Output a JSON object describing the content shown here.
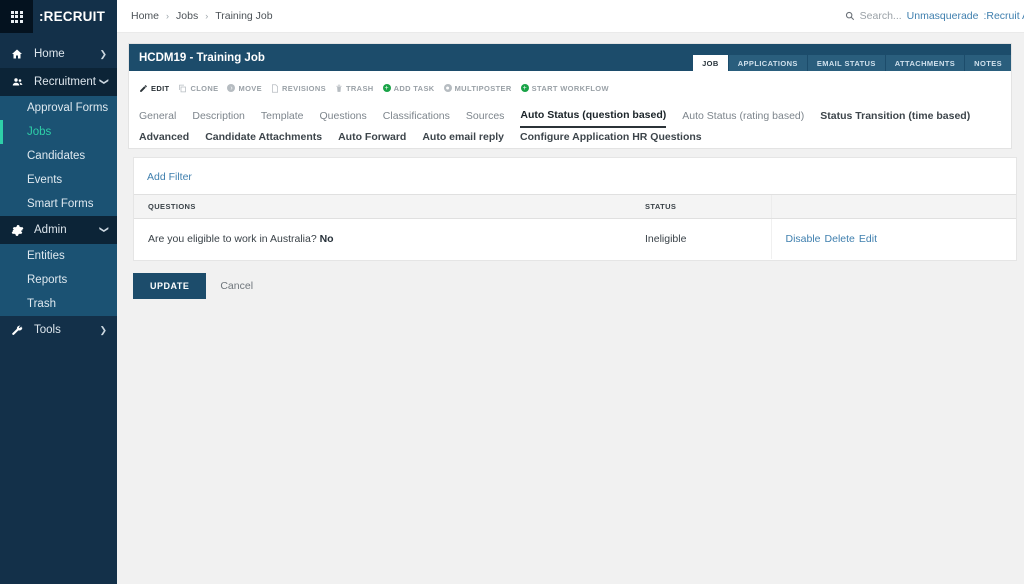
{
  "sidebar": {
    "logo_icon": "grid-apps-icon",
    "brand": ":RECRUIT",
    "groups": [
      {
        "label": "Home",
        "icon": "home-icon",
        "chevron": "chevron-right-icon",
        "expanded": false,
        "items": []
      },
      {
        "label": "Recruitment",
        "icon": "people-icon",
        "chevron": "chevron-down-icon",
        "expanded": true,
        "items": [
          {
            "label": "Approval Forms",
            "active": false
          },
          {
            "label": "Jobs",
            "active": true
          },
          {
            "label": "Candidates",
            "active": false
          },
          {
            "label": "Events",
            "active": false
          },
          {
            "label": "Smart Forms",
            "active": false
          }
        ]
      },
      {
        "label": "Admin",
        "icon": "gear-icon",
        "chevron": "chevron-down-icon",
        "expanded": true,
        "items": [
          {
            "label": "Entities",
            "active": false
          },
          {
            "label": "Reports",
            "active": false
          },
          {
            "label": "Trash",
            "active": false
          }
        ]
      },
      {
        "label": "Tools",
        "icon": "wrench-icon",
        "chevron": "chevron-right-icon",
        "expanded": false,
        "items": []
      }
    ],
    "accent_color": "#2ecfa8",
    "bg_color": "#133049",
    "submenu_bg_color": "#1b5273"
  },
  "topbar": {
    "breadcrumbs": [
      "Home",
      "Jobs",
      "Training Job"
    ],
    "separator": "›",
    "search_icon": "search-icon",
    "search_placeholder": "Search...",
    "unmasquerade_label": "Unmasquerade",
    "user_label": ":Recruit A"
  },
  "record": {
    "title": "HCDM19 - Training Job",
    "header_bg": "#1c4c6b",
    "header_tabs": [
      {
        "label": "JOB",
        "active": true
      },
      {
        "label": "APPLICATIONS",
        "active": false
      },
      {
        "label": "EMAIL STATUS",
        "active": false
      },
      {
        "label": "ATTACHMENTS",
        "active": false
      },
      {
        "label": "NOTES",
        "active": false
      }
    ],
    "actions": [
      {
        "label": "EDIT",
        "icon": "pencil-icon",
        "style": "primary"
      },
      {
        "label": "CLONE",
        "icon": "copy-icon",
        "style": "muted"
      },
      {
        "label": "MOVE",
        "icon": "circle-arrow-icon",
        "style": "muted"
      },
      {
        "label": "REVISIONS",
        "icon": "document-icon",
        "style": "muted"
      },
      {
        "label": "TRASH",
        "icon": "trash-icon",
        "style": "muted"
      },
      {
        "label": "ADD TASK",
        "icon": "circle-plus-icon",
        "style": "green"
      },
      {
        "label": "MULTIPOSTER",
        "icon": "circle-icon",
        "style": "muted"
      },
      {
        "label": "START WORKFLOW",
        "icon": "circle-plus-icon",
        "style": "green"
      }
    ]
  },
  "tabs": [
    {
      "label": "General",
      "state": "normal"
    },
    {
      "label": "Description",
      "state": "normal"
    },
    {
      "label": "Template",
      "state": "normal"
    },
    {
      "label": "Questions",
      "state": "normal"
    },
    {
      "label": "Classifications",
      "state": "normal"
    },
    {
      "label": "Sources",
      "state": "normal"
    },
    {
      "label": "Auto Status (question based)",
      "state": "active"
    },
    {
      "label": "Auto Status (rating based)",
      "state": "normal"
    },
    {
      "label": "Status Transition (time based)",
      "state": "strong"
    },
    {
      "label": "Advanced",
      "state": "strong"
    },
    {
      "label": "Candidate Attachments",
      "state": "strong"
    },
    {
      "label": "Auto Forward",
      "state": "strong"
    },
    {
      "label": "Auto email reply",
      "state": "strong"
    },
    {
      "label": "Configure Application HR Questions",
      "state": "strong"
    }
  ],
  "panel": {
    "add_filter_label": "Add Filter",
    "table": {
      "columns": [
        "QUESTIONS",
        "STATUS",
        ""
      ],
      "rows": [
        {
          "question": "Are you eligible to work in Australia?",
          "answer": "No",
          "status": "Ineligible",
          "links": [
            "Disable",
            "Delete",
            "Edit"
          ]
        }
      ]
    }
  },
  "footer": {
    "update_label": "UPDATE",
    "cancel_label": "Cancel",
    "update_bg": "#1c4c6b"
  }
}
